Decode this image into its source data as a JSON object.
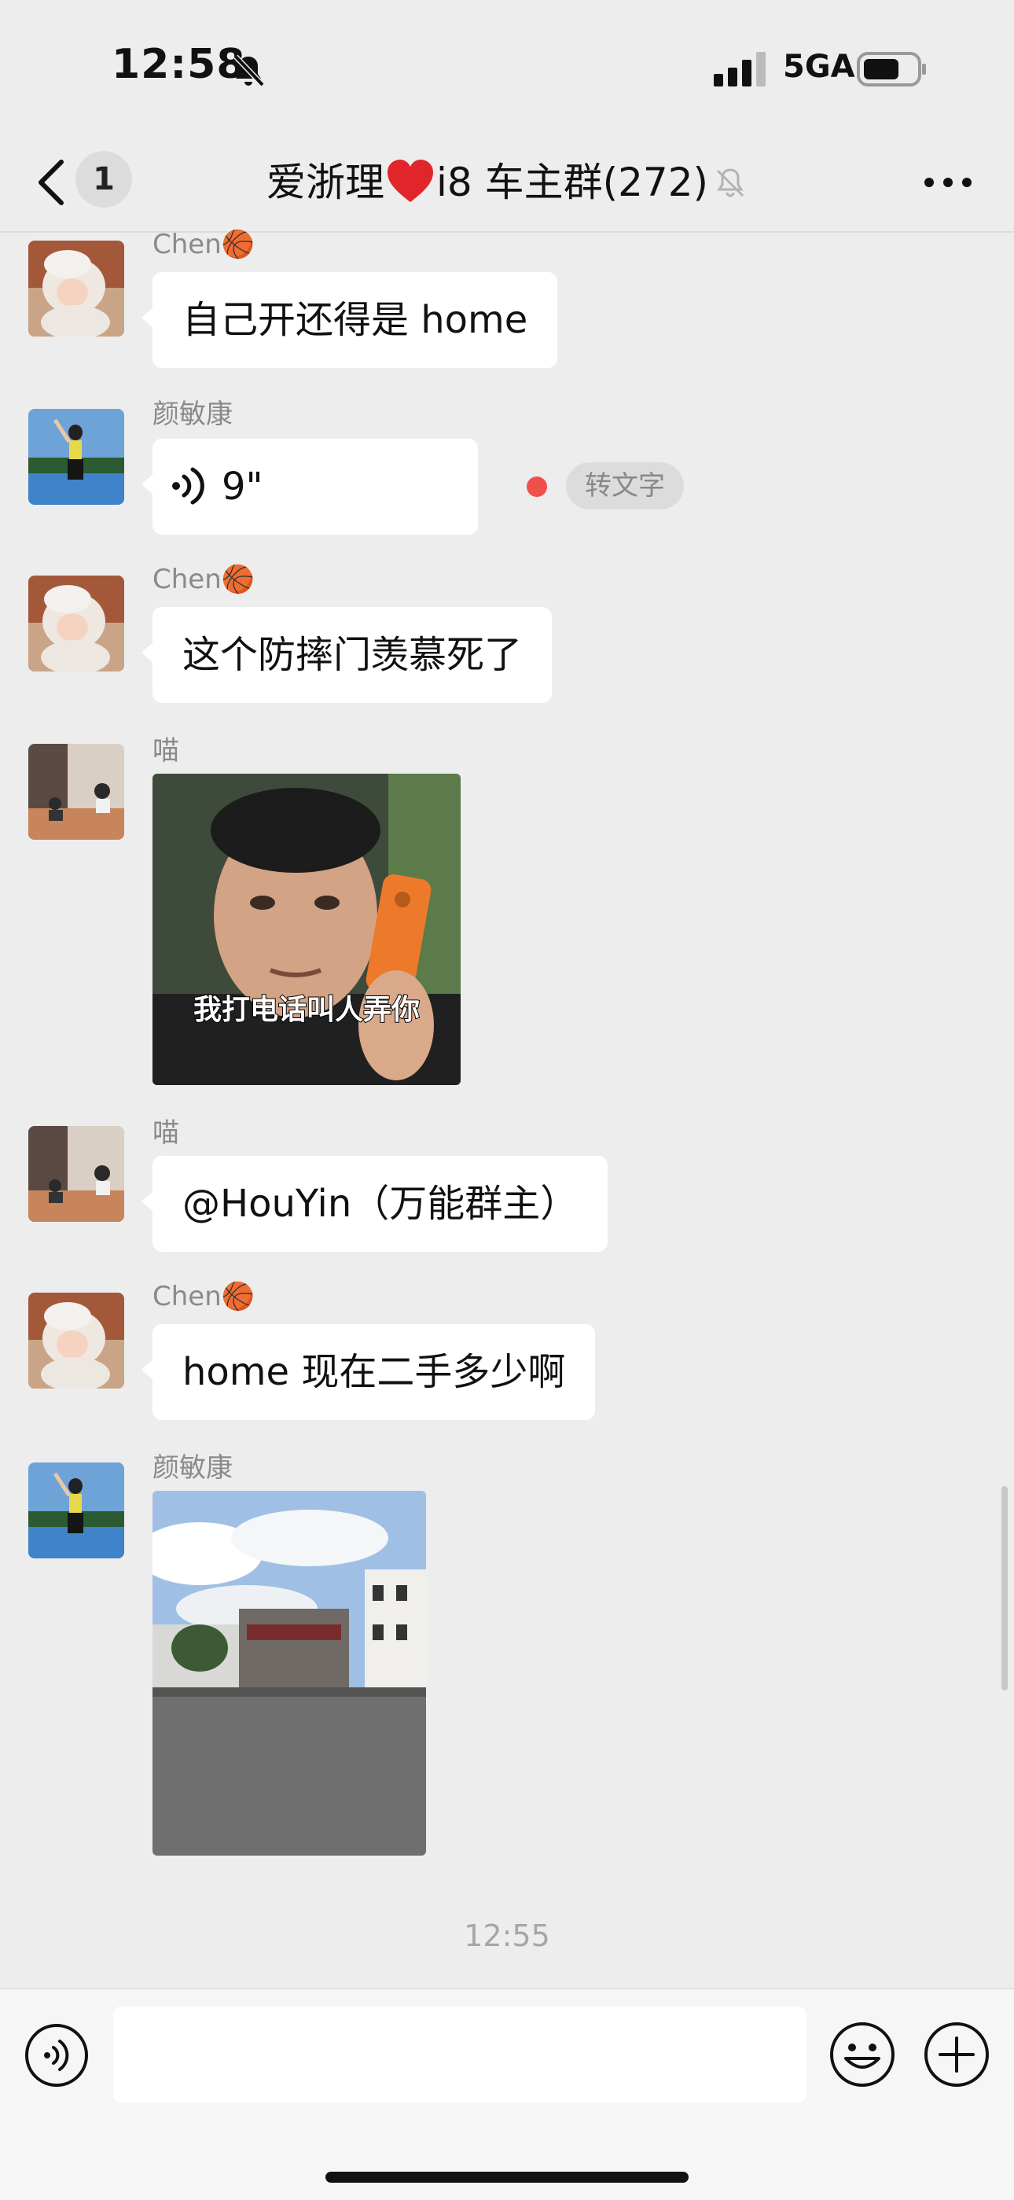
{
  "status_bar": {
    "time": "12:58",
    "network": "5GA",
    "icons": [
      "bell-off-icon",
      "signal-icon",
      "battery-icon"
    ]
  },
  "nav": {
    "unread_count": "1",
    "title_prefix": "爱浙理",
    "title_suffix": "i8 车主群",
    "member_count": "(272)",
    "icons": [
      "back-chevron-icon",
      "heart-icon",
      "mute-icon",
      "more-icon"
    ]
  },
  "messages": [
    {
      "sender": "Chen🏀",
      "type": "text",
      "text": "自己开还得是 home"
    },
    {
      "sender": "颜敏康",
      "type": "voice",
      "duration": "9\"",
      "to_text_label": "转文字"
    },
    {
      "sender": "Chen🏀",
      "type": "text",
      "text": "这个防摔门羡慕死了"
    },
    {
      "sender": "喵",
      "type": "sticker",
      "caption": "我打电话叫人弄你"
    },
    {
      "sender": "喵",
      "type": "text",
      "text": "@HouYin（万能群主）"
    },
    {
      "sender": "Chen🏀",
      "type": "text",
      "text": "home 现在二手多少啊"
    },
    {
      "sender": "颜敏康",
      "type": "image",
      "description": "photo-building-plaza"
    }
  ],
  "time_divider": "12:55",
  "input_bar": {
    "placeholder": "",
    "icons": [
      "voice-toggle-icon",
      "emoji-icon",
      "plus-icon"
    ]
  },
  "colors": {
    "background": "#ededed",
    "bubble": "#ffffff",
    "unread_dot": "#f0504a",
    "heart": "#e0262b"
  }
}
